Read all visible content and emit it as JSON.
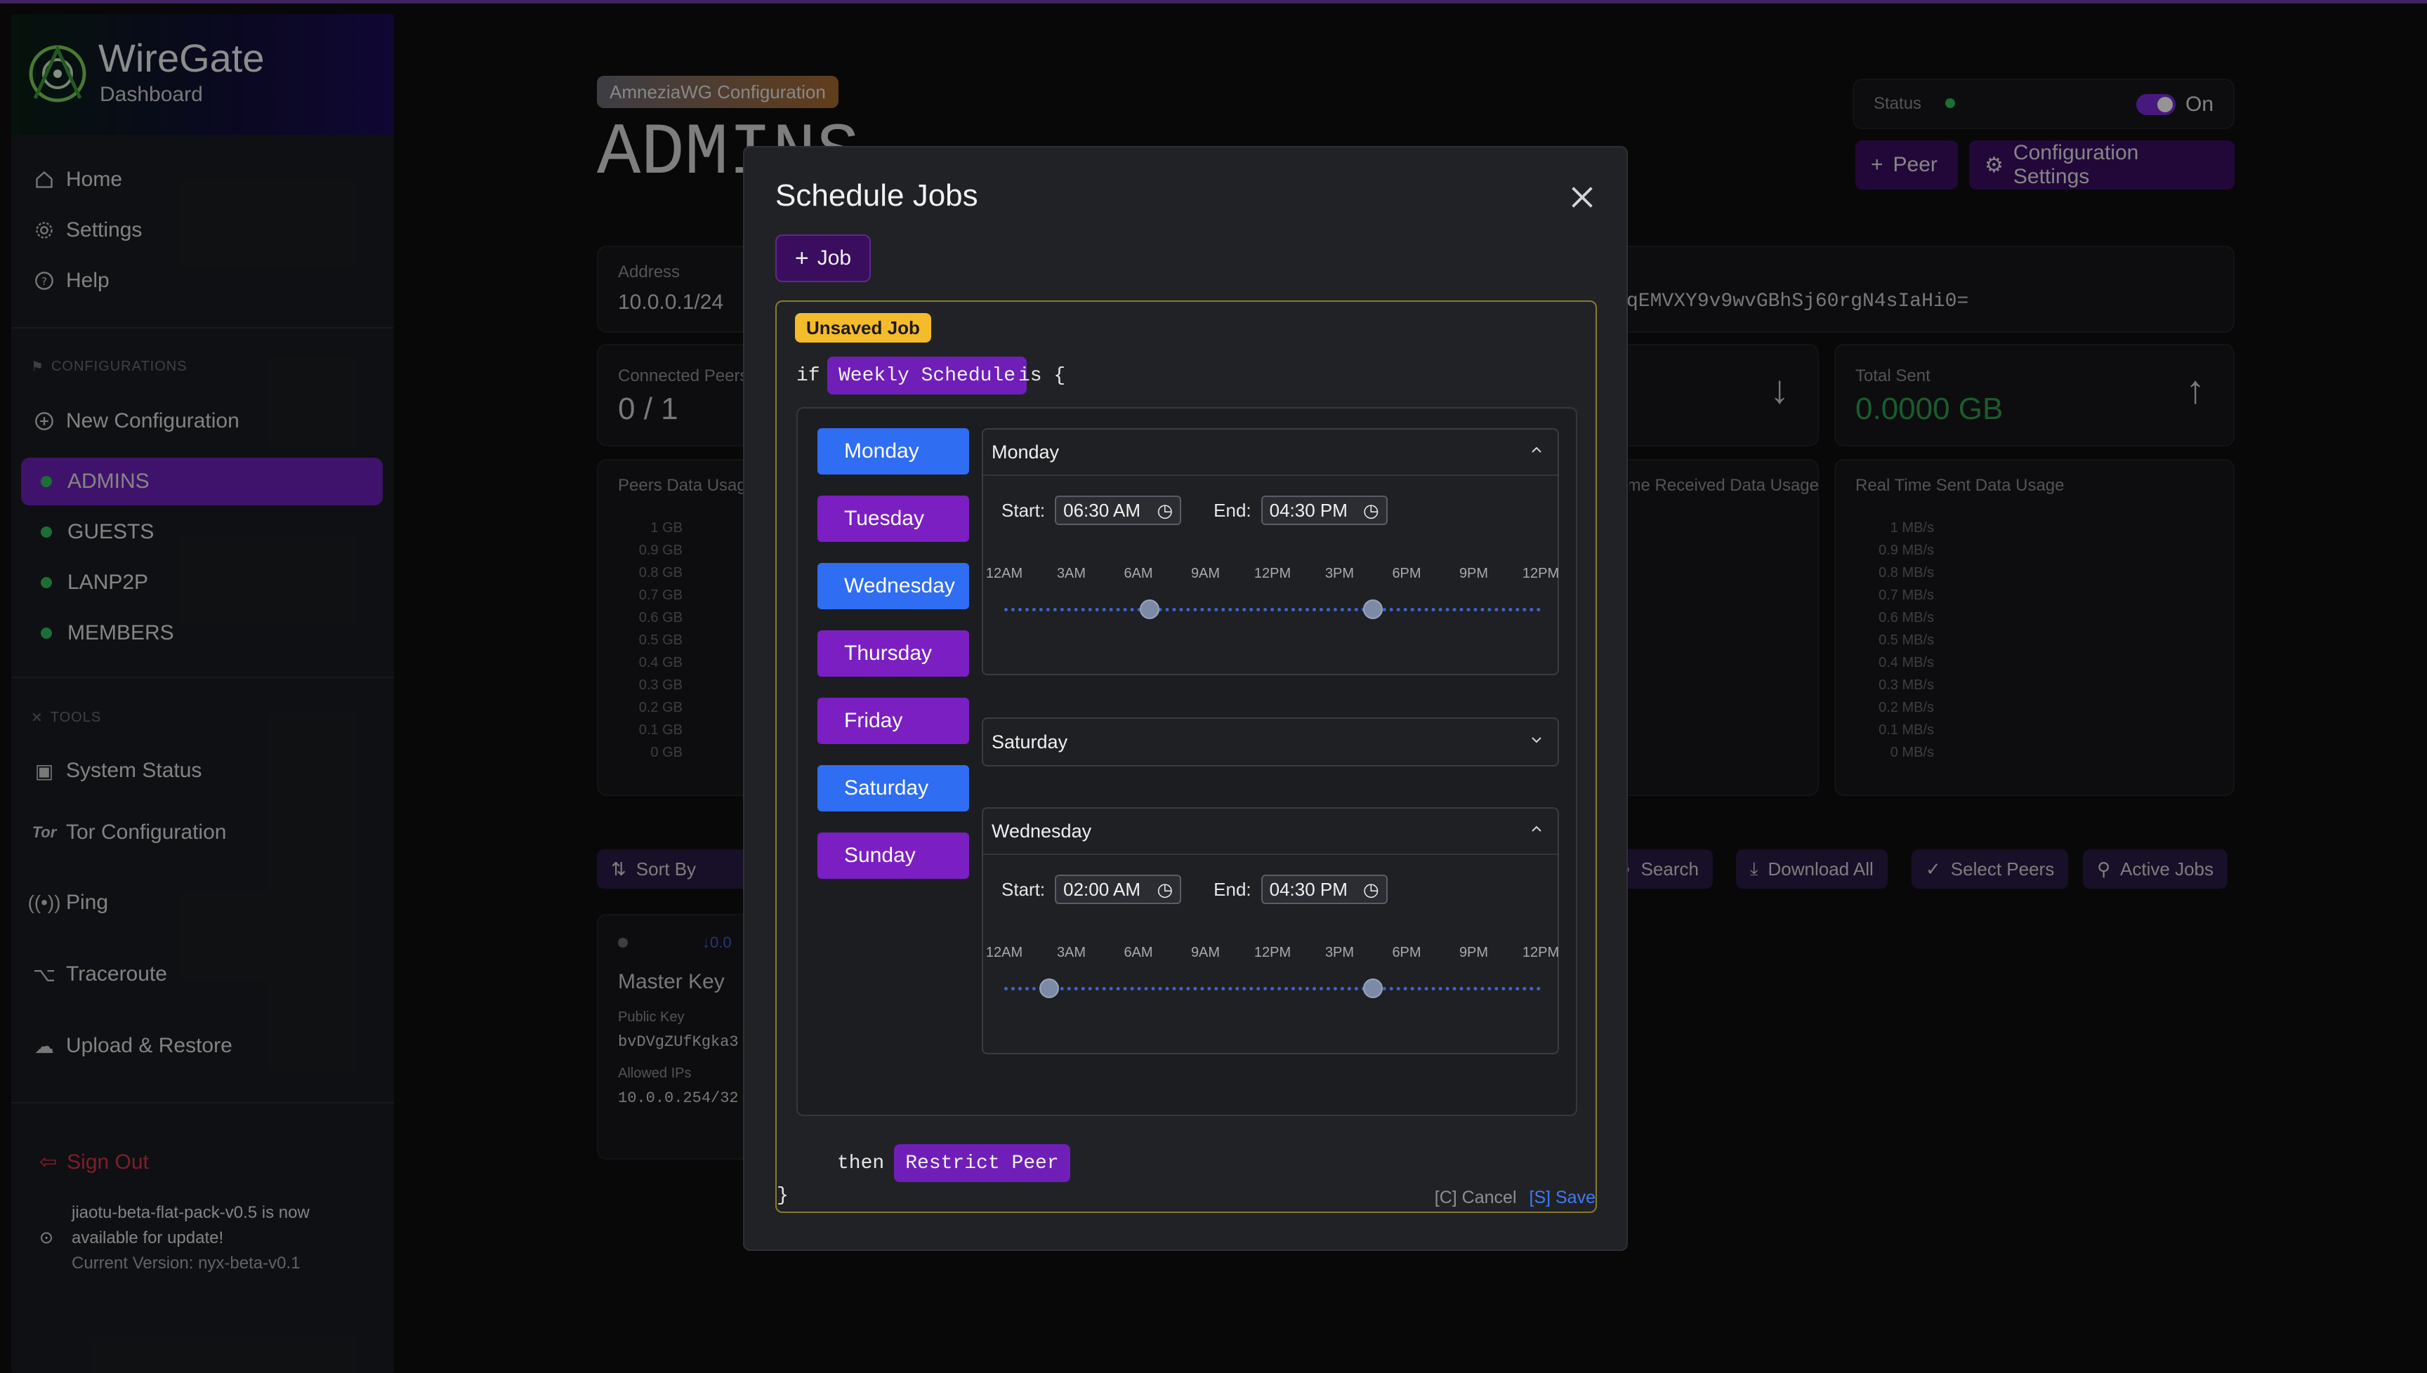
{
  "app": {
    "name": "WireGate",
    "subtitle": "Dashboard"
  },
  "sidebar": {
    "nav": [
      {
        "label": "Home",
        "icon": "home-icon"
      },
      {
        "label": "Settings",
        "icon": "gear-icon"
      },
      {
        "label": "Help",
        "icon": "help-icon"
      }
    ],
    "configurations_label": "CONFIGURATIONS",
    "new_configuration": "New Configuration",
    "configs": [
      {
        "label": "ADMINS",
        "active": true
      },
      {
        "label": "GUESTS",
        "active": false
      },
      {
        "label": "LANP2P",
        "active": false
      },
      {
        "label": "MEMBERS",
        "active": false
      }
    ],
    "tools_label": "TOOLS",
    "tools": [
      {
        "label": "System Status",
        "icon": "system-status-icon"
      },
      {
        "label": "Tor Configuration",
        "icon": "tor-icon"
      },
      {
        "label": "Ping",
        "icon": "ping-icon"
      },
      {
        "label": "Traceroute",
        "icon": "traceroute-icon"
      },
      {
        "label": "Upload & Restore",
        "icon": "upload-icon"
      }
    ],
    "sign_out": "Sign Out",
    "update": {
      "line1": "jiaotu-beta-flat-pack-v0.5 is now available for update!",
      "line2": "Current Version: nyx-beta-v0.1"
    }
  },
  "page": {
    "config_tag": "AmneziaWG Configuration",
    "title": "ADMINS",
    "status_label": "Status",
    "status_value": "On",
    "peer_button": "Peer",
    "config_settings_button": "Configuration Settings",
    "address_label": "Address",
    "address_value": "10.0.0.1/24",
    "public_key_fragment": "qEMVXY9v9wvGBhSj60rgN4sIaHi0=",
    "connected_peers_label": "Connected Peers",
    "connected_peers_value": "0 / 1",
    "total_sent_label": "Total Sent",
    "total_sent_value": "0.0000 GB",
    "peers_usage_label": "Peers Data Usage",
    "received_usage_label": "Real Time Received Data Usage",
    "sent_usage_label": "Real Time Sent Data Usage",
    "gb_axis": [
      "1 GB",
      "0.9 GB",
      "0.8 GB",
      "0.7 GB",
      "0.6 GB",
      "0.5 GB",
      "0.4 GB",
      "0.3 GB",
      "0.2 GB",
      "0.1 GB",
      "0 GB"
    ],
    "mbs_axis": [
      "1 MB/s",
      "0.9 MB/s",
      "0.8 MB/s",
      "0.7 MB/s",
      "0.6 MB/s",
      "0.5 MB/s",
      "0.4 MB/s",
      "0.3 MB/s",
      "0.2 MB/s",
      "0.1 MB/s",
      "0 MB/s"
    ],
    "sort_by": "Sort By",
    "toolbar": {
      "search": "Search",
      "download_all": "Download All",
      "select_peers": "Select Peers",
      "active_jobs": "Active Jobs"
    },
    "peer_card": {
      "name": "Master Key",
      "public_key_label": "Public Key",
      "public_key": "bvDVgZUfKgka3",
      "allowed_ips_label": "Allowed IPs",
      "allowed_ips": "10.0.0.254/32",
      "rate": "↓0.0"
    }
  },
  "modal": {
    "title": "Schedule Jobs",
    "add_job": "Job",
    "unsaved_badge": "Unsaved Job",
    "if_keyword": "if",
    "condition": "Weekly Schedule",
    "is_keyword": "is {",
    "days": [
      {
        "label": "Monday",
        "selected": true
      },
      {
        "label": "Tuesday",
        "selected": false
      },
      {
        "label": "Wednesday",
        "selected": true
      },
      {
        "label": "Thursday",
        "selected": false
      },
      {
        "label": "Friday",
        "selected": false
      },
      {
        "label": "Saturday",
        "selected": true
      },
      {
        "label": "Sunday",
        "selected": false
      }
    ],
    "schedules": [
      {
        "day": "Monday",
        "expanded": true,
        "start_label": "Start:",
        "start": "06:30 AM",
        "end_label": "End:",
        "end": "04:30 PM",
        "range_hours": [
          6.5,
          16.5
        ]
      },
      {
        "day": "Saturday",
        "expanded": false
      },
      {
        "day": "Wednesday",
        "expanded": true,
        "start_label": "Start:",
        "start": "02:00 AM",
        "end_label": "End:",
        "end": "04:30 PM",
        "range_hours": [
          2,
          16.5
        ]
      }
    ],
    "time_ticks": [
      "12AM",
      "3AM",
      "6AM",
      "9AM",
      "12PM",
      "3PM",
      "6PM",
      "9PM",
      "12PM"
    ],
    "then_keyword": "then",
    "action": "Restrict Peer",
    "closing_brace": "}",
    "cancel": "[C] Cancel",
    "save": "[S] Save"
  },
  "colors": {
    "accent_purple": "#7b1fc2",
    "day_selected_blue": "#2f6df2",
    "unsaved_yellow": "#f4bb2b",
    "status_green": "#2fbf5a",
    "sign_out_red": "#d8344a"
  }
}
